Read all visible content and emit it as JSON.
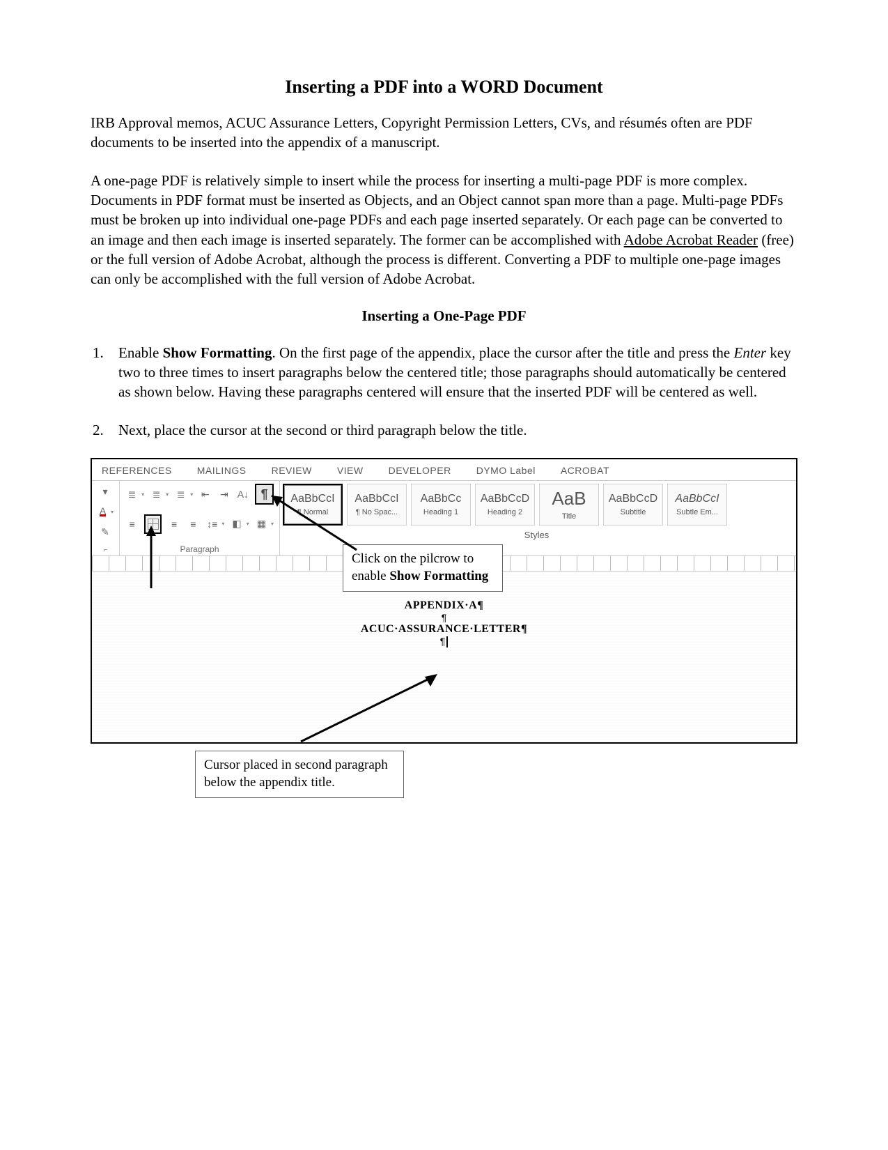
{
  "title": "Inserting a PDF into a WORD Document",
  "intro": [
    "IRB Approval memos, ACUC Assurance Letters, Copyright Permission Letters, CVs, and résumés often are PDF documents to be inserted into the appendix of a manuscript.",
    "A one-page PDF is relatively simple to insert while the process for inserting a multi-page PDF is more complex. Documents in PDF format must be inserted as Objects, and an Object cannot span more than a page. Multi-page PDFs must be broken up into individual one-page PDFs and each page inserted separately. Or each page can be converted to an image and then each image is inserted separately. The former can be accomplished with ",
    "Adobe Acrobat Reader",
    " (free) or the full version of Adobe Acrobat, although the process is different. Converting a PDF to multiple one-page images can only be accomplished with the full version of Adobe Acrobat."
  ],
  "subheading": "Inserting a One-Page PDF",
  "steps": {
    "s1_a": "Enable ",
    "s1_b": "Show Formatting",
    "s1_c": ". On the first page of the appendix, place the cursor after the title and press the ",
    "s1_d": "Enter",
    "s1_e": " key two to three times to insert paragraphs below the centered title; those paragraphs should automatically be centered as shown below. Having these paragraphs centered will ensure that the inserted PDF will be centered as well.",
    "s2": "Next, place the cursor at the second or third paragraph below the title."
  },
  "word": {
    "tabs": [
      "REFERENCES",
      "MAILINGS",
      "REVIEW",
      "VIEW",
      "DEVELOPER",
      "DYMO Label",
      "ACROBAT"
    ],
    "group_paragraph": "Paragraph",
    "group_styles": "Styles",
    "styles": [
      {
        "preview": "AaBbCcI",
        "name": "¶ Normal",
        "selected": true,
        "big": false,
        "ital": false
      },
      {
        "preview": "AaBbCcI",
        "name": "¶ No Spac...",
        "selected": false,
        "big": false,
        "ital": false
      },
      {
        "preview": "AaBbCc",
        "name": "Heading 1",
        "selected": false,
        "big": false,
        "ital": false
      },
      {
        "preview": "AaBbCcD",
        "name": "Heading 2",
        "selected": false,
        "big": false,
        "ital": false
      },
      {
        "preview": "AaB",
        "name": "Title",
        "selected": false,
        "big": true,
        "ital": false
      },
      {
        "preview": "AaBbCcD",
        "name": "Subtitle",
        "selected": false,
        "big": false,
        "ital": false
      },
      {
        "preview": "AaBbCcI",
        "name": "Subtle Em...",
        "selected": false,
        "big": false,
        "ital": true
      }
    ],
    "doc_lines": {
      "l1": "APPENDIX·A¶",
      "l2": "¶",
      "l3": "ACUC·ASSURANCE·LETTER¶",
      "l4": "¶"
    }
  },
  "callouts": {
    "c1_a": "Click on the pilcrow to enable ",
    "c1_b": "Show Formatting",
    "c2": "Cursor placed in second paragraph below the appendix title."
  }
}
